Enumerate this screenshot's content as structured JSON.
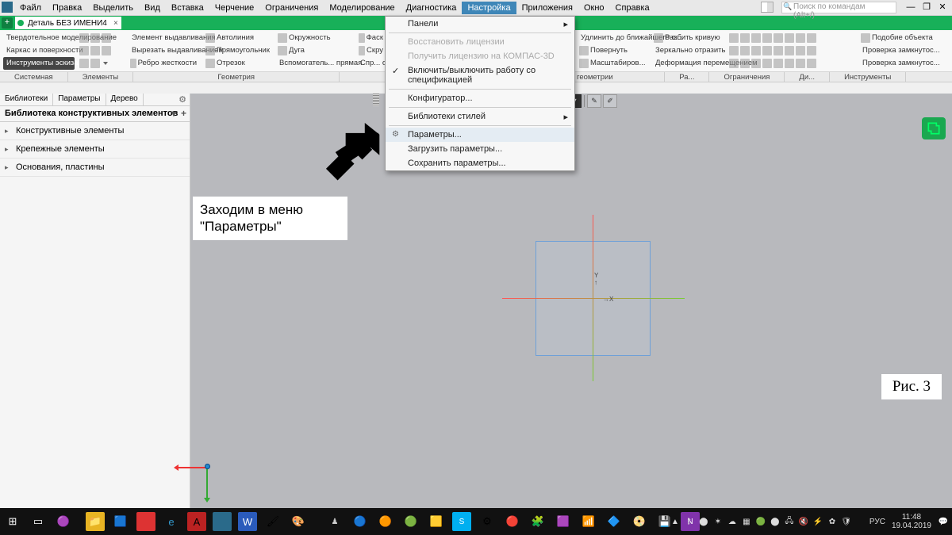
{
  "menubar": {
    "items": [
      "Файл",
      "Правка",
      "Выделить",
      "Вид",
      "Вставка",
      "Черчение",
      "Ограничения",
      "Моделирование",
      "Диагностика",
      "Настройка",
      "Приложения",
      "Окно",
      "Справка"
    ],
    "active_index": 9,
    "search_placeholder": "Поиск по командам (Alt+/)"
  },
  "tab": {
    "title": "Деталь БЕЗ ИМЕНИ4"
  },
  "ribbon": {
    "col1": [
      "Твердотельное моделирование",
      "Каркас и поверхности",
      "Инструменты эскиза"
    ],
    "col2": [
      "Элемент выдавливания",
      "Вырезать выдавливанием",
      "Ребро жесткости"
    ],
    "col3": [
      "Автолиния",
      "Прямоугольник",
      "Отрезок"
    ],
    "col4": [
      "Окружность",
      "Дуга",
      "Вспомогатель... прямая"
    ],
    "col5": [
      "Фаск",
      "Скру",
      "Спр... объе"
    ],
    "col6": [
      "Удлинить до ближайшего о...",
      "Повернуть",
      "Масштабиров..."
    ],
    "col7": [
      "Разбить кривую",
      "Зеркально отразить",
      "Деформация перемещением"
    ],
    "col8": [
      "Подобие объекта",
      "Проверка замкнутос...",
      "Проверка замкнутос..."
    ],
    "footer": [
      "Системная",
      "Элементы",
      "Геометрия",
      "",
      "",
      "",
      "менение геометрии",
      "Ра...",
      "Ограничения",
      "Ди...",
      "Инструменты"
    ]
  },
  "dropdown": {
    "items": [
      {
        "label": "Панели",
        "kind": "sub"
      },
      {
        "kind": "sep"
      },
      {
        "label": "Восстановить лицензии",
        "kind": "disabled"
      },
      {
        "label": "Получить лицензию на КОМПАС-3D",
        "kind": "disabled"
      },
      {
        "label": "Включить/выключить работу со спецификацией",
        "kind": "check"
      },
      {
        "kind": "sep"
      },
      {
        "label": "Конфигуратор..."
      },
      {
        "kind": "sep"
      },
      {
        "label": "Библиотеки стилей",
        "kind": "sub"
      },
      {
        "kind": "sep"
      },
      {
        "label": "Параметры...",
        "kind": "gear hl"
      },
      {
        "label": "Загрузить параметры..."
      },
      {
        "label": "Сохранить параметры..."
      }
    ]
  },
  "leftpanel": {
    "tabs": [
      "Библиотеки",
      "Параметры",
      "Дерево"
    ],
    "header": "Библиотека конструктивных элементов",
    "items": [
      "Конструктивные элементы",
      "Крепежные элементы",
      "Основания, пластины"
    ]
  },
  "canvas_axes": {
    "x": "X",
    "y": "Y"
  },
  "annotation": {
    "line1": "Заходим в меню",
    "line2": "\"Параметры\"",
    "figure": "Рис. 3"
  },
  "taskbar": {
    "lang": "РУС",
    "time": "11:48",
    "date": "19.04.2019"
  }
}
